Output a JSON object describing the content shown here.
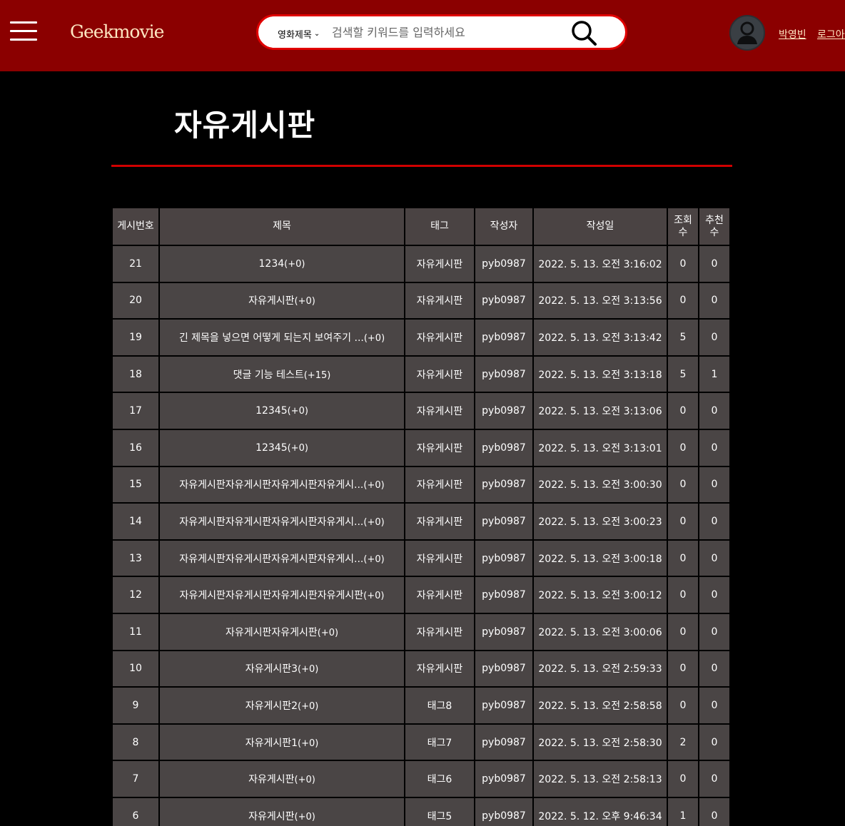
{
  "header": {
    "logo": "Geekmovie",
    "search": {
      "select_value": "영화제목",
      "placeholder": "검색할 키워드를 입력하세요"
    },
    "user_name": "박영빈",
    "login_link": "로그아웃"
  },
  "page_title": "자유게시판",
  "table": {
    "columns": [
      "게시번호",
      "제목",
      "태그",
      "작성자",
      "작성일",
      "조회수",
      "추천수"
    ],
    "rows": [
      {
        "no": "21",
        "title": "1234",
        "comments": "(+0)",
        "tag": "자유게시판",
        "author": "pyb0987",
        "date": "2022. 5. 13. 오전 3:16:02",
        "views": "0",
        "recommend": "0"
      },
      {
        "no": "20",
        "title": "자유게시판",
        "comments": "(+0)",
        "tag": "자유게시판",
        "author": "pyb0987",
        "date": "2022. 5. 13. 오전 3:13:56",
        "views": "0",
        "recommend": "0"
      },
      {
        "no": "19",
        "title": "긴 제목을 넣으면 어떻게 되는지 보여주기 ...",
        "comments": "(+0)",
        "tag": "자유게시판",
        "author": "pyb0987",
        "date": "2022. 5. 13. 오전 3:13:42",
        "views": "5",
        "recommend": "0"
      },
      {
        "no": "18",
        "title": "댓글 기능 테스트",
        "comments": "(+15)",
        "tag": "자유게시판",
        "author": "pyb0987",
        "date": "2022. 5. 13. 오전 3:13:18",
        "views": "5",
        "recommend": "1"
      },
      {
        "no": "17",
        "title": "12345",
        "comments": "(+0)",
        "tag": "자유게시판",
        "author": "pyb0987",
        "date": "2022. 5. 13. 오전 3:13:06",
        "views": "0",
        "recommend": "0"
      },
      {
        "no": "16",
        "title": "12345",
        "comments": "(+0)",
        "tag": "자유게시판",
        "author": "pyb0987",
        "date": "2022. 5. 13. 오전 3:13:01",
        "views": "0",
        "recommend": "0"
      },
      {
        "no": "15",
        "title": "자유게시판자유게시판자유게시판자유게시...",
        "comments": "(+0)",
        "tag": "자유게시판",
        "author": "pyb0987",
        "date": "2022. 5. 13. 오전 3:00:30",
        "views": "0",
        "recommend": "0"
      },
      {
        "no": "14",
        "title": "자유게시판자유게시판자유게시판자유게시...",
        "comments": "(+0)",
        "tag": "자유게시판",
        "author": "pyb0987",
        "date": "2022. 5. 13. 오전 3:00:23",
        "views": "0",
        "recommend": "0"
      },
      {
        "no": "13",
        "title": "자유게시판자유게시판자유게시판자유게시...",
        "comments": "(+0)",
        "tag": "자유게시판",
        "author": "pyb0987",
        "date": "2022. 5. 13. 오전 3:00:18",
        "views": "0",
        "recommend": "0"
      },
      {
        "no": "12",
        "title": "자유게시판자유게시판자유게시판자유게시판",
        "comments": "(+0)",
        "tag": "자유게시판",
        "author": "pyb0987",
        "date": "2022. 5. 13. 오전 3:00:12",
        "views": "0",
        "recommend": "0"
      },
      {
        "no": "11",
        "title": "자유게시판자유게시판",
        "comments": "(+0)",
        "tag": "자유게시판",
        "author": "pyb0987",
        "date": "2022. 5. 13. 오전 3:00:06",
        "views": "0",
        "recommend": "0"
      },
      {
        "no": "10",
        "title": "자유게시판3",
        "comments": "(+0)",
        "tag": "자유게시판",
        "author": "pyb0987",
        "date": "2022. 5. 13. 오전 2:59:33",
        "views": "0",
        "recommend": "0"
      },
      {
        "no": "9",
        "title": "자유게시판2",
        "comments": "(+0)",
        "tag": "태그8",
        "author": "pyb0987",
        "date": "2022. 5. 13. 오전 2:58:58",
        "views": "0",
        "recommend": "0"
      },
      {
        "no": "8",
        "title": "자유게시판1",
        "comments": "(+0)",
        "tag": "태그7",
        "author": "pyb0987",
        "date": "2022. 5. 13. 오전 2:58:30",
        "views": "2",
        "recommend": "0"
      },
      {
        "no": "7",
        "title": "자유게시판",
        "comments": "(+0)",
        "tag": "태그6",
        "author": "pyb0987",
        "date": "2022. 5. 13. 오전 2:58:13",
        "views": "0",
        "recommend": "0"
      },
      {
        "no": "6",
        "title": "자유게시판",
        "comments": "(+0)",
        "tag": "태그5",
        "author": "pyb0987",
        "date": "2022. 5. 12. 오후 9:46:34",
        "views": "1",
        "recommend": "0"
      }
    ]
  },
  "icons": [
    "menu-icon",
    "search-icon",
    "user-avatar-icon",
    "chevron-down-icon"
  ],
  "colors": {
    "header_bg": "#8b0000",
    "accent": "#e00000",
    "cell_bg": "#4a4545",
    "logo": "#ffe7c2"
  }
}
